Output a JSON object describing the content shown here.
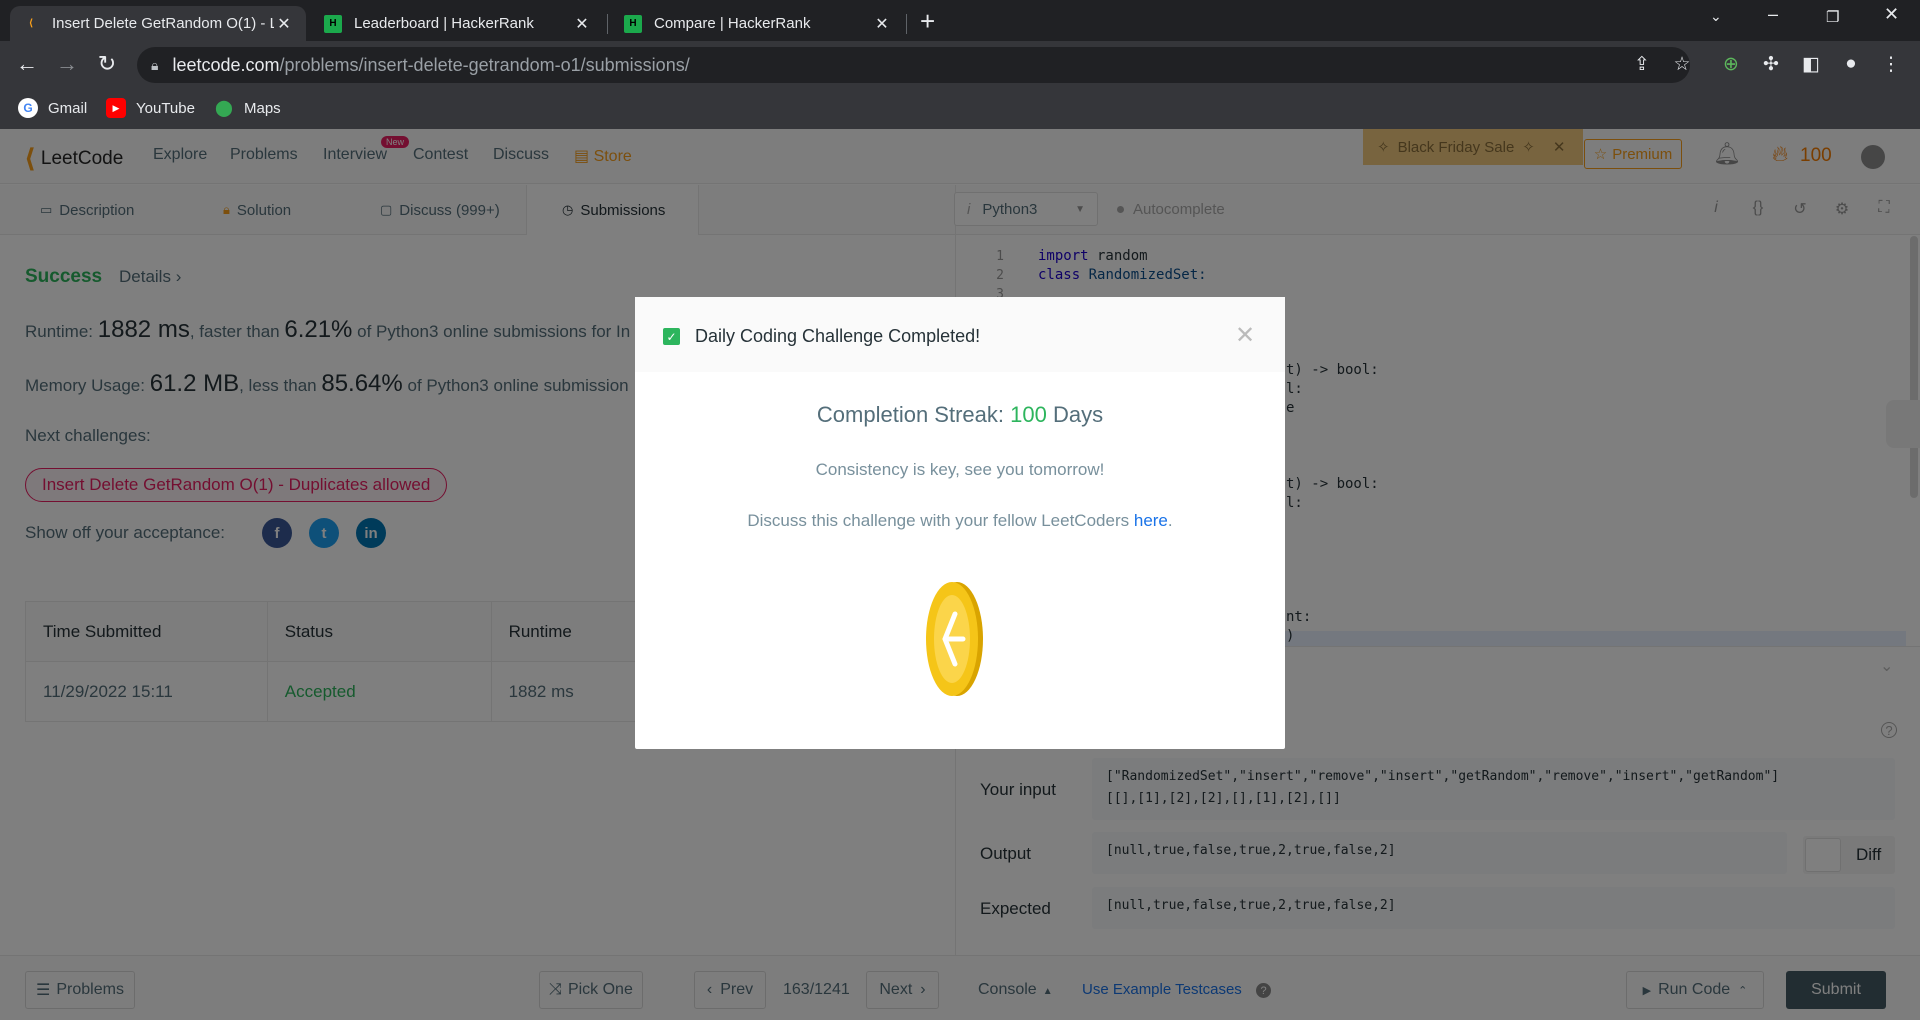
{
  "browser": {
    "tabs": [
      {
        "title": "Insert Delete GetRandom O(1) - L",
        "favicon": "leetcode-icon"
      },
      {
        "title": "Leaderboard | HackerRank",
        "favicon": "hackerrank-icon"
      },
      {
        "title": "Compare | HackerRank",
        "favicon": "hackerrank-icon"
      }
    ],
    "url_domain": "leetcode.com",
    "url_path": "/problems/insert-delete-getrandom-o1/submissions/",
    "bookmarks": [
      {
        "label": "Gmail",
        "icon": "google-icon"
      },
      {
        "label": "YouTube",
        "icon": "youtube-icon"
      },
      {
        "label": "Maps",
        "icon": "maps-icon"
      }
    ]
  },
  "nav": {
    "logo": "LeetCode",
    "links": [
      "Explore",
      "Problems",
      "Interview",
      "Contest",
      "Discuss",
      "Store"
    ],
    "new_badge": "New",
    "sale": "Black Friday Sale",
    "premium": "Premium",
    "streak_count": "100"
  },
  "left_tabs": [
    "Description",
    "Solution",
    "Discuss (999+)",
    "Submissions"
  ],
  "result": {
    "status": "Success",
    "details": "Details",
    "runtime_label": "Runtime:",
    "runtime_value": "1882 ms",
    "runtime_mid": ", faster than",
    "runtime_pct": "6.21%",
    "runtime_tail": "of Python3 online submissions for In",
    "memory_label": "Memory Usage:",
    "memory_value": "61.2 MB",
    "memory_mid": ", less than",
    "memory_pct": "85.64%",
    "memory_tail": "of Python3 online submission",
    "next_label": "Next challenges:",
    "next_challenge": "Insert Delete GetRandom O(1) - Duplicates allowed",
    "showoff_label": "Show off your acceptance:"
  },
  "submissions": {
    "headers": [
      "Time Submitted",
      "Status",
      "Runtime"
    ],
    "rows": [
      {
        "time": "11/29/2022 15:11",
        "status": "Accepted",
        "runtime": "1882 ms"
      }
    ]
  },
  "editor": {
    "language": "Python3",
    "autocomplete": "Autocomplete",
    "line_numbers": [
      "1",
      "2",
      "3"
    ],
    "code_visible": {
      "line1_kw": "import",
      "line1_rest": " random",
      "line2_kw": "class",
      "line2_rest": " RandomizedSet:",
      "frag1": "t) -> bool:",
      "frag2": "l:",
      "frag3": "e",
      "frag4": "t) -> bool:",
      "frag5": "l:",
      "frag6": "nt:",
      "frag7": ")"
    }
  },
  "console_panel": {
    "your_input_label": "Your input",
    "your_input_line1": "[\"RandomizedSet\",\"insert\",\"remove\",\"insert\",\"getRandom\",\"remove\",\"insert\",\"getRandom\"]",
    "your_input_line2": "[[],[1],[2],[2],[],[1],[2],[]]",
    "output_label": "Output",
    "output": "[null,true,false,true,2,true,false,2]",
    "expected_label": "Expected",
    "expected": "[null,true,false,true,2,true,false,2]",
    "diff": "Diff"
  },
  "bottom": {
    "problems": "Problems",
    "pick_one": "Pick One",
    "prev": "Prev",
    "page": "163/1241",
    "next": "Next",
    "console": "Console",
    "use_example": "Use Example Testcases",
    "run_code": "Run Code",
    "submit": "Submit"
  },
  "modal": {
    "title": "Daily Coding Challenge Completed!",
    "streak_label": "Completion Streak:",
    "streak_num": "100",
    "streak_unit": "Days",
    "line1": "Consistency is key, see you tomorrow!",
    "line2": "Discuss this challenge with your fellow LeetCoders",
    "link": "here",
    "link_tail": "."
  }
}
